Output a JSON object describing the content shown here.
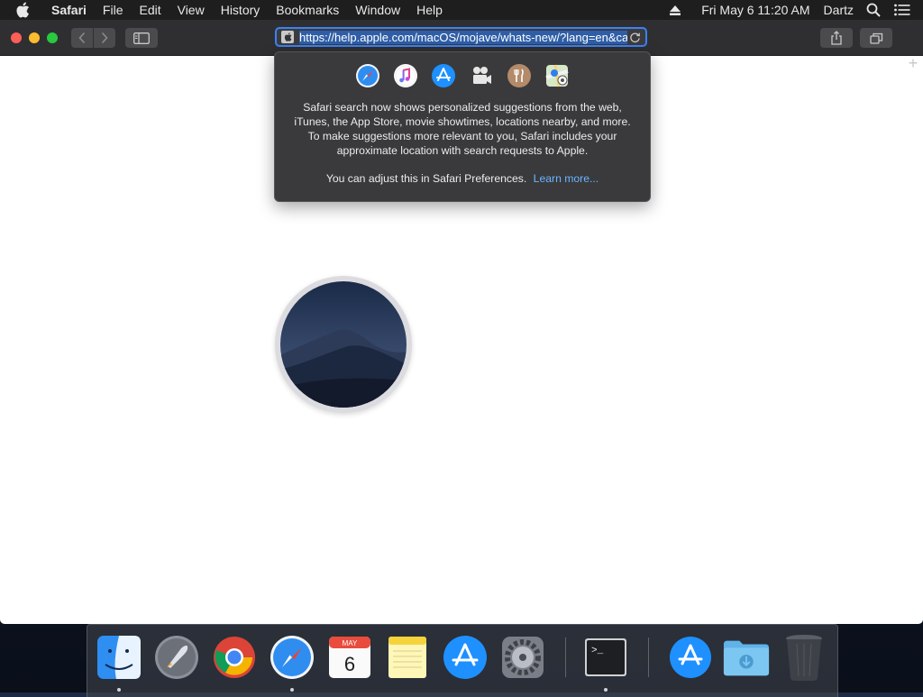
{
  "menubar": {
    "app": "Safari",
    "menus": [
      "File",
      "Edit",
      "View",
      "History",
      "Bookmarks",
      "Window",
      "Help"
    ],
    "clock": "Fri May 6  11:20 AM",
    "user": "Dartz"
  },
  "toolbar": {
    "url": "https://help.apple.com/macOS/mojave/whats-new/?lang=en&ca",
    "new_tab": "+"
  },
  "popover": {
    "description": "Safari search now shows personalized suggestions from the web, iTunes, the App Store, movie showtimes, locations nearby, and more. To make suggestions more relevant to you, Safari includes your approximate location with search requests to Apple.",
    "adjust_text": "You can adjust this in Safari Preferences.",
    "learn_more": "Learn more...",
    "icons": [
      "safari-icon",
      "itunes-icon",
      "app-store-icon",
      "movies-icon",
      "restaurants-icon",
      "maps-icon"
    ]
  },
  "dock": {
    "items": [
      "Finder",
      "Launchpad",
      "Google Chrome",
      "Safari",
      "Calendar",
      "Notes",
      "App Store",
      "System Preferences",
      "Terminal",
      "App Store Download",
      "Downloads",
      "Trash"
    ],
    "calendar_month": "MAY",
    "calendar_day": "6",
    "terminal_prompt": ">_"
  },
  "colors": {
    "accent": "#3a82f7",
    "link": "#6cb4ff",
    "close": "#fc5f57",
    "minimize": "#fdbc2e",
    "maximize": "#28c840"
  }
}
